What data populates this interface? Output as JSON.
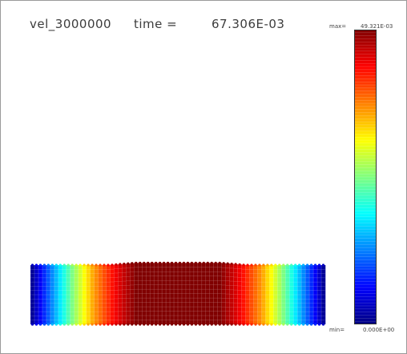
{
  "header": {
    "variable_name": "vel_3000000",
    "time_label": "time =",
    "time_value": "67.306E-03"
  },
  "colorbar": {
    "max_label": "max=",
    "max_value": "49.321E-03",
    "min_label": "min=",
    "min_value": "0.000E+00",
    "colors_top_to_bottom": [
      "#7f0000",
      "#ff0000",
      "#ff7f00",
      "#ffff00",
      "#7fff7f",
      "#00ffff",
      "#007fff",
      "#0000ff",
      "#00007f"
    ]
  },
  "field": {
    "colormap": "jet",
    "profile_left_to_right": [
      0.0,
      0.25,
      0.5,
      0.72,
      0.88,
      1.0,
      1.0,
      1.0,
      1.0,
      1.0,
      0.88,
      0.72,
      0.5,
      0.25,
      0.0
    ]
  }
}
